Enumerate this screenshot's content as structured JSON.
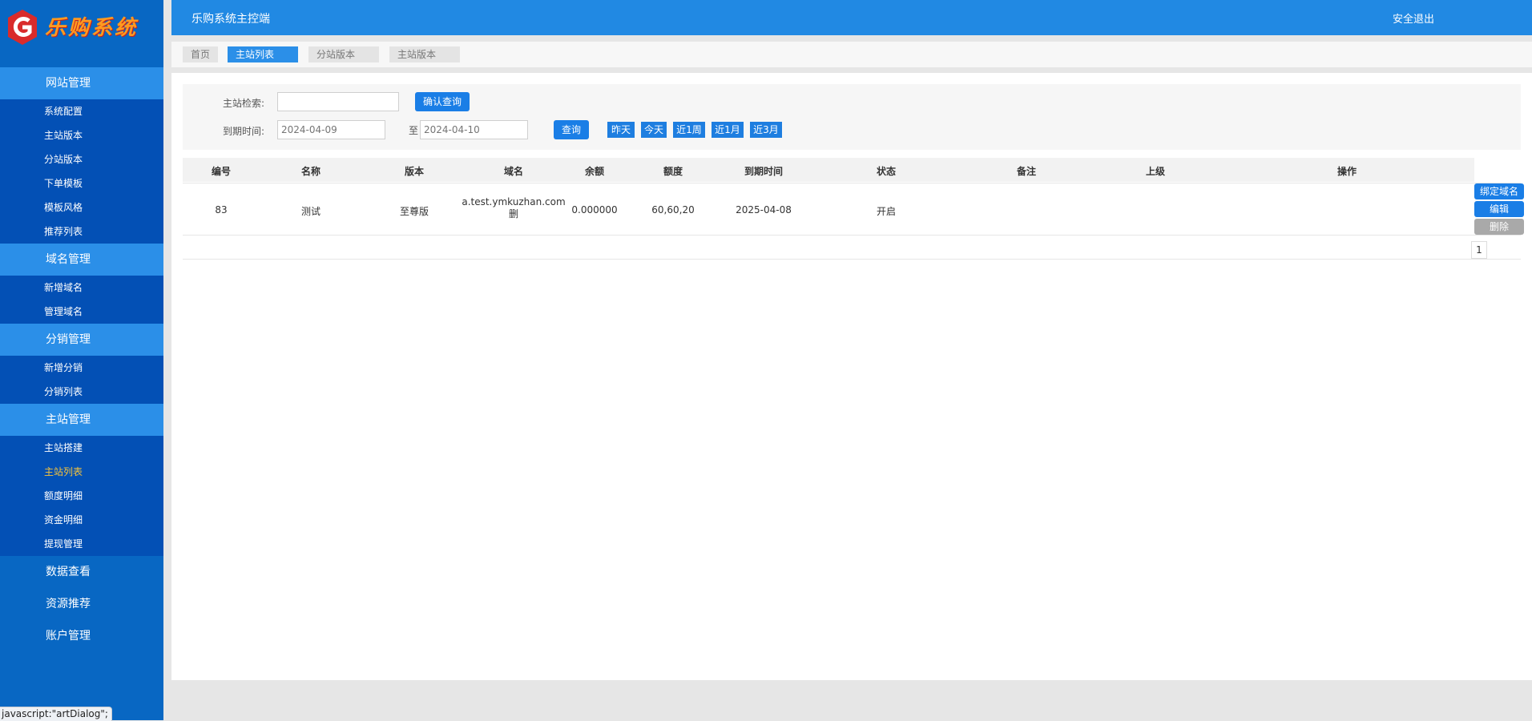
{
  "logo": {
    "text": "乐购系统"
  },
  "sidebar": {
    "groups": [
      {
        "label": "网站管理",
        "items": [
          "系统配置",
          "主站版本",
          "分站版本",
          "下单模板",
          "模板风格",
          "推荐列表"
        ]
      },
      {
        "label": "域名管理",
        "items": [
          "新增域名",
          "管理域名"
        ]
      },
      {
        "label": "分销管理",
        "items": [
          "新增分销",
          "分销列表"
        ]
      },
      {
        "label": "主站管理",
        "items": [
          "主站搭建",
          "主站列表",
          "额度明细",
          "资金明细",
          "提现管理"
        ]
      }
    ],
    "plain": [
      "数据查看",
      "资源推荐",
      "账户管理"
    ],
    "active_item": "主站列表"
  },
  "status_url": "javascript:\"artDialog\";",
  "header": {
    "title": "乐购系统主控端",
    "logout": "安全退出"
  },
  "tabs": [
    "首页",
    "主站列表",
    "分站版本",
    "主站版本"
  ],
  "active_tab": "主站列表",
  "search": {
    "label": "主站检索:",
    "value": "",
    "confirm": "确认查询",
    "date_label": "到期时间:",
    "date_from": "2024-04-09",
    "date_to": "2024-04-10",
    "to_label": "至",
    "query": "查询",
    "quick": [
      "昨天",
      "今天",
      "近1周",
      "近1月",
      "近3月"
    ]
  },
  "table": {
    "headers": [
      "编号",
      "名称",
      "版本",
      "域名",
      "余额",
      "额度",
      "到期时间",
      "状态",
      "备注",
      "上级",
      "操作"
    ],
    "rows": [
      {
        "id": "83",
        "name": "测试",
        "version": "至尊版",
        "domain": "a.test.ymkuzhan.com",
        "domain_del": "删",
        "balance": "0.000000",
        "quota": "60,60,20",
        "expire": "2025-04-08",
        "status": "开启",
        "remark": "",
        "parent": ""
      }
    ],
    "actions": [
      "绑定域名",
      "编辑",
      "删除"
    ]
  },
  "pager": {
    "current": "1"
  },
  "colors": {
    "header": "#2189e3",
    "sidebar": "#0867c3",
    "sidebar_group": "#2b8fe8",
    "sidebar_sub": "#0350b5",
    "accent": "#1a7ee6"
  }
}
